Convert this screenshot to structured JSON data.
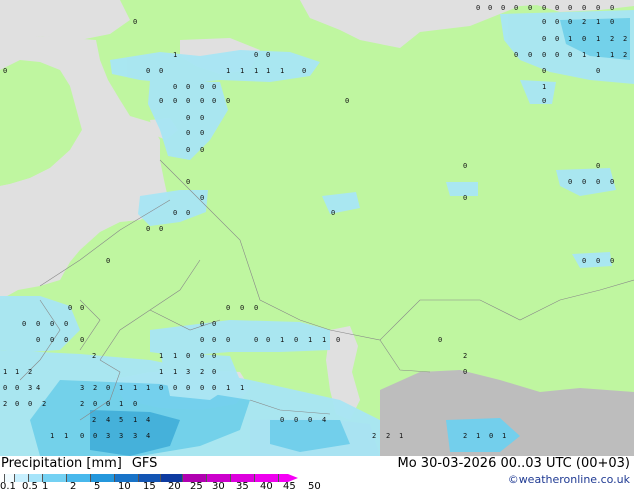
{
  "map": {
    "colors": {
      "sea": "#e0e0e0",
      "land_precip": "#bff6a0",
      "land_dry": "#bdbdbd",
      "border": "#888888",
      "rain_light": "#a8e6f5",
      "rain_medium": "#6fd0ee",
      "rain_heavy": "#3faede",
      "rain_strong": "#2787c8"
    },
    "station_values": [
      "0",
      "0",
      "0",
      "0",
      "0",
      "0",
      "0",
      "0",
      "0",
      "0",
      "0",
      "0",
      "0",
      "0",
      "2",
      "1",
      "0",
      "0",
      "0",
      "0",
      "1",
      "0",
      "1",
      "2",
      "2",
      "0",
      "0",
      "0",
      "0",
      "0",
      "1",
      "1",
      "1",
      "2",
      "0",
      "0",
      "0",
      "1",
      "0",
      "0",
      "1",
      "1",
      "1",
      "1",
      "1",
      "0",
      "0",
      "0",
      "0",
      "0",
      "0",
      "0",
      "0",
      "0",
      "0",
      "0",
      "0",
      "0",
      "1",
      "0",
      "0",
      "0",
      "0",
      "0",
      "0",
      "0",
      "0",
      "0",
      "0",
      "0",
      "0",
      "0",
      "0",
      "0",
      "0",
      "0",
      "0",
      "0",
      "0",
      "0",
      "0",
      "0",
      "0",
      "0",
      "0",
      "0",
      "0",
      "0",
      "0",
      "0",
      "0",
      "0",
      "0",
      "0",
      "0",
      "0",
      "0",
      "0",
      "0",
      "0",
      "0",
      "0",
      "0",
      "0",
      "0",
      "0",
      "1",
      "0",
      "1",
      "1",
      "0",
      "0",
      "2",
      "2",
      "1",
      "1",
      "0",
      "0",
      "0",
      "1",
      "1",
      "2",
      "1",
      "1",
      "3",
      "2",
      "0",
      "0",
      "0",
      "0",
      "3",
      "4",
      "3",
      "2",
      "0",
      "1",
      "1",
      "1",
      "0",
      "0",
      "0",
      "0",
      "0",
      "1",
      "1",
      "2",
      "0",
      "0",
      "2",
      "2",
      "0",
      "0",
      "1",
      "0",
      "2",
      "4",
      "5",
      "1",
      "4",
      "1",
      "1",
      "0",
      "0",
      "3",
      "3",
      "3",
      "4",
      "2",
      "1",
      "0",
      "1",
      "2",
      "2",
      "1",
      "0",
      "0",
      "0",
      "4",
      "1",
      "3",
      "0",
      "1",
      "0",
      "0",
      "1",
      "0",
      "1"
    ]
  },
  "footer": {
    "label_precip": "Precipitation [mm]",
    "label_model": "GFS",
    "valid_time": "Mo 30-03-2026 00..03 UTC (00+03)",
    "credit": "©weatheronline.co.uk"
  },
  "legend": {
    "labels": [
      "0.1",
      "0.5",
      "1",
      "2",
      "5",
      "10",
      "15",
      "20",
      "25",
      "30",
      "35",
      "40",
      "45",
      "50"
    ],
    "colors": [
      "#f0fbff",
      "#c8f0ff",
      "#a6e4fa",
      "#74d1f3",
      "#48b8ec",
      "#2497dc",
      "#1873c8",
      "#1355b4",
      "#0e3ba0",
      "#b000b0",
      "#cc00cc",
      "#dd00dd",
      "#ee00ee",
      "#f600f6"
    ]
  }
}
